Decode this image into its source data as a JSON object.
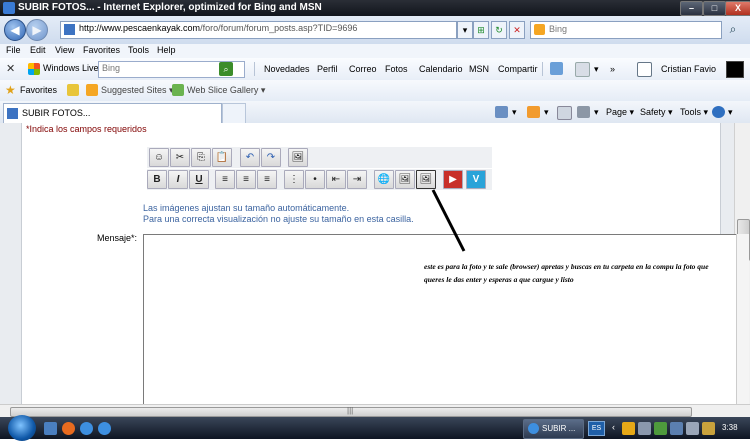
{
  "window": {
    "title": "SUBIR FOTOS... - Internet Explorer, optimized for Bing and MSN",
    "minimize": "–",
    "maximize": "□",
    "close": "X"
  },
  "address": {
    "url_host": "http://www.pescaenkayak.com",
    "url_path": "/foro/forum/forum_posts.asp?TID=9696",
    "search_placeholder": "Bing"
  },
  "menu": [
    "File",
    "Edit",
    "View",
    "Favorites",
    "Tools",
    "Help"
  ],
  "live_toolbar": {
    "close": "✕",
    "brand": "Windows Live",
    "search_placeholder": "Bing",
    "links": [
      "Novedades",
      "Perfil",
      "Correo",
      "Fotos",
      "Calendario",
      "MSN",
      "Compartir"
    ],
    "user": "Cristian Favio"
  },
  "favorites_bar": {
    "label": "Favorites",
    "items": [
      "Suggested Sites ▾",
      "Web Slice Gallery ▾"
    ]
  },
  "tab": {
    "label": "SUBIR FOTOS..."
  },
  "command_bar": [
    "Page ▾",
    "Safety ▾",
    "Tools ▾"
  ],
  "form": {
    "required_note": "*Indica los campos requeridos",
    "toolbar_row1": [
      "☺",
      "✂",
      "⎘",
      "📋",
      "↶",
      "↷",
      "🖼"
    ],
    "toolbar_row2": [
      "B",
      "I",
      "U",
      "≡",
      "≡",
      "≡",
      "⋮",
      "•",
      "⇤",
      "⇥",
      "🌐",
      "🖼",
      "🖼",
      "▶",
      "V"
    ],
    "note_line1": "Las imágenes ajustan su tamaño automáticamente.",
    "note_line2": "Para una correcta visualización no ajuste su tamaño en esta casilla.",
    "message_label": "Mensaje*:",
    "annotation": "este es para la foto y te sale (browser) apretas y buscas en tu carpeta en la compu la foto que queres le das enter y esperas a que cargue y listo"
  },
  "hscroll": {
    "grip": "|||"
  },
  "taskbar": {
    "task_label": "SUBIR ...",
    "language": "ES",
    "clock": "3:38"
  }
}
